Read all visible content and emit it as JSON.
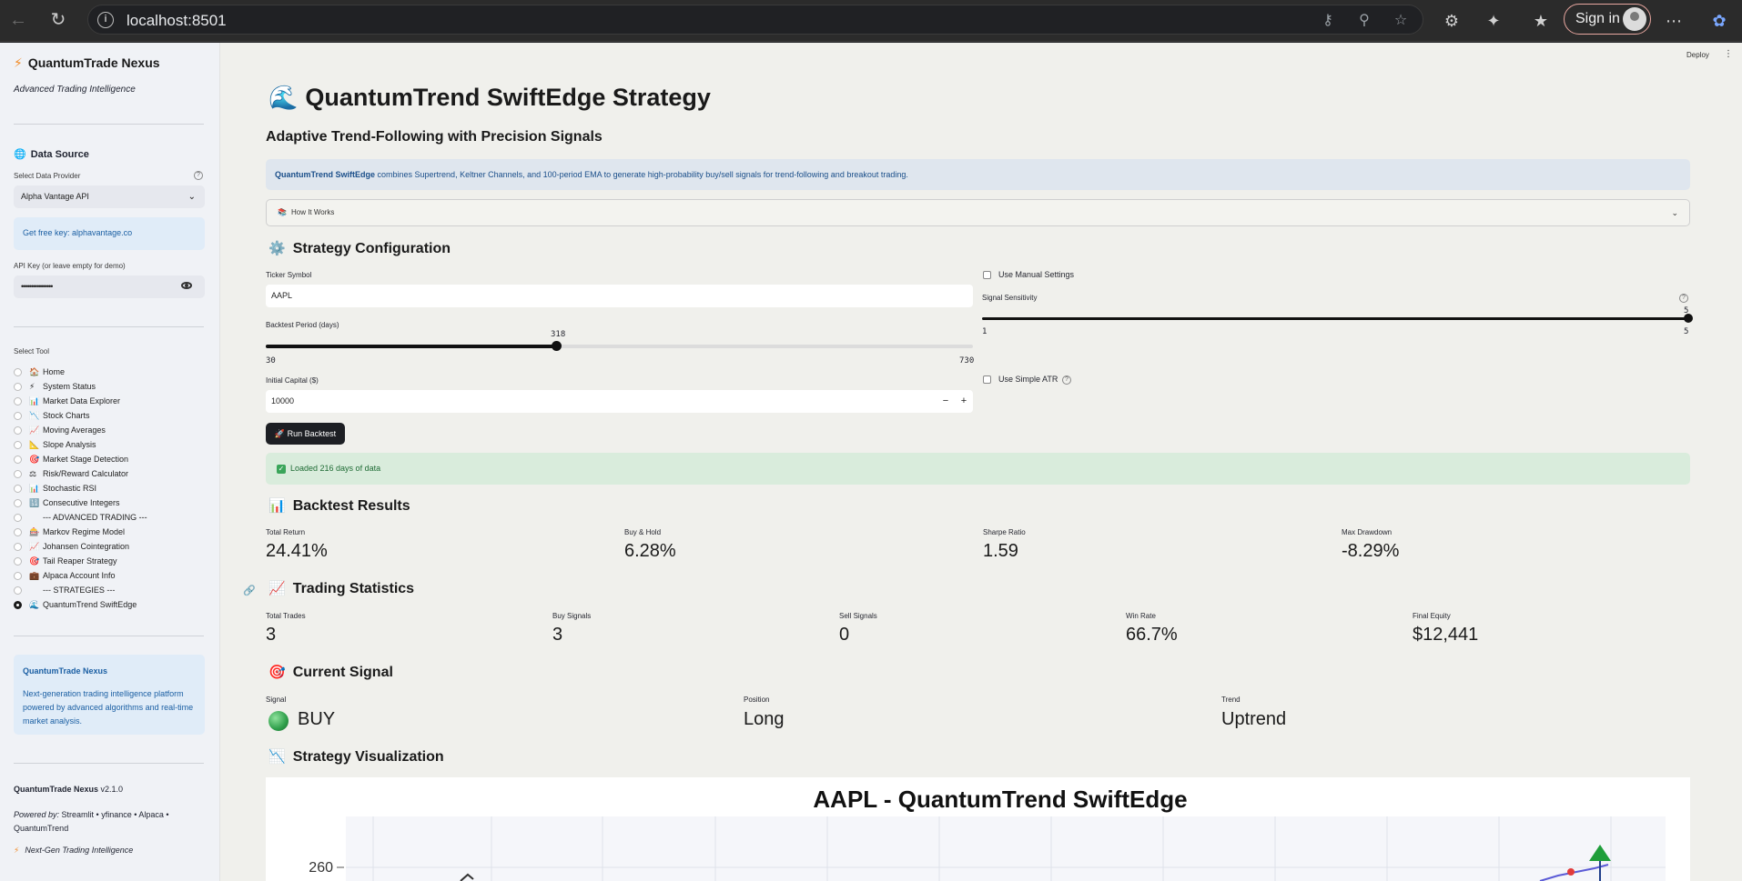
{
  "browser": {
    "url": "localhost:8501",
    "signin_label": "Sign in"
  },
  "app": {
    "deploy_label": "Deploy"
  },
  "sidebar": {
    "brand": "QuantumTrade Nexus",
    "tagline": "Advanced Trading Intelligence",
    "data_source_title": "Data Source",
    "provider_label": "Select Data Provider",
    "provider_value": "Alpha Vantage API",
    "free_key_prefix": "Get free key: ",
    "free_key_link": "alphavantage.co",
    "api_key_label": "API Key (or leave empty for demo)",
    "api_key_value": "••••••••••••••••",
    "tool_label": "Select Tool",
    "tools": [
      {
        "icon": "🏠",
        "label": "Home"
      },
      {
        "icon": "⚡",
        "label": "System Status"
      },
      {
        "icon": "📊",
        "label": "Market Data Explorer"
      },
      {
        "icon": "📉",
        "label": "Stock Charts"
      },
      {
        "icon": "📈",
        "label": "Moving Averages"
      },
      {
        "icon": "📐",
        "label": "Slope Analysis"
      },
      {
        "icon": "🎯",
        "label": "Market Stage Detection"
      },
      {
        "icon": "⚖",
        "label": "Risk/Reward Calculator"
      },
      {
        "icon": "📊",
        "label": "Stochastic RSI"
      },
      {
        "icon": "🔢",
        "label": "Consecutive Integers"
      },
      {
        "icon": "",
        "label": "--- ADVANCED TRADING ---"
      },
      {
        "icon": "🎰",
        "label": "Markov Regime Model"
      },
      {
        "icon": "📈",
        "label": "Johansen Cointegration"
      },
      {
        "icon": "🎯",
        "label": "Tail Reaper Strategy"
      },
      {
        "icon": "💼",
        "label": "Alpaca Account Info"
      },
      {
        "icon": "",
        "label": "--- STRATEGIES ---"
      },
      {
        "icon": "🌊",
        "label": "QuantumTrend SwiftEdge"
      }
    ],
    "selected_tool": "QuantumTrend SwiftEdge",
    "info_title": "QuantumTrade Nexus",
    "info_text": "Next-generation trading intelligence platform powered by advanced algorithms and real-time market analysis.",
    "version_name": "QuantumTrade Nexus",
    "version": "v2.1.0",
    "powered_prefix": "Powered by:",
    "powered_list": "Streamlit • yfinance • Alpaca • QuantumTrend",
    "footer_tag": "Next-Gen Trading Intelligence"
  },
  "main": {
    "title_icon": "🌊",
    "title": "QuantumTrend SwiftEdge Strategy",
    "subtitle": "Adaptive Trend-Following with Precision Signals",
    "banner_bold": "QuantumTrend SwiftEdge",
    "banner_text": " combines Supertrend, Keltner Channels, and 100-period EMA to generate high-probability buy/sell signals for trend-following and breakout trading.",
    "expander_icon": "📚",
    "expander_label": "How It Works",
    "config_icon": "⚙️",
    "config_title": "Strategy Configuration",
    "ticker_label": "Ticker Symbol",
    "ticker_value": "AAPL",
    "backtest_label": "Backtest Period (days)",
    "backtest_value": "318",
    "backtest_min": "30",
    "backtest_max": "730",
    "backtest_fraction": 0.411,
    "capital_label": "Initial Capital ($)",
    "capital_value": "10000",
    "run_label": "🚀 Run Backtest",
    "manual_label": "Use Manual Settings",
    "sensitivity_label": "Signal Sensitivity",
    "sensitivity_value": "5",
    "sensitivity_min": "1",
    "sensitivity_max": "5",
    "atr_label": "Use Simple ATR",
    "success_text": "Loaded 216 days of data",
    "results_icon": "📊",
    "results_title": "Backtest Results",
    "results": [
      {
        "label": "Total Return",
        "value": "24.41%"
      },
      {
        "label": "Buy & Hold",
        "value": "6.28%"
      },
      {
        "label": "Sharpe Ratio",
        "value": "1.59"
      },
      {
        "label": "Max Drawdown",
        "value": "-8.29%"
      }
    ],
    "stats_icon": "📈",
    "stats_title": "Trading Statistics",
    "stats": [
      {
        "label": "Total Trades",
        "value": "3"
      },
      {
        "label": "Buy Signals",
        "value": "3"
      },
      {
        "label": "Sell Signals",
        "value": "0"
      },
      {
        "label": "Win Rate",
        "value": "66.7%"
      },
      {
        "label": "Final Equity",
        "value": "$12,441"
      }
    ],
    "signal_icon": "🎯",
    "signal_title": "Current Signal",
    "signal": [
      {
        "label": "Signal",
        "value": "BUY"
      },
      {
        "label": "Position",
        "value": "Long"
      },
      {
        "label": "Trend",
        "value": "Uptrend"
      }
    ],
    "viz_icon": "📉",
    "viz_title": "Strategy Visualization",
    "chart_title": "AAPL - QuantumTrend SwiftEdge",
    "chart_ytick": "260"
  },
  "colors": {
    "accent_dark": "#1d1f24",
    "info_bg": "#e0ecf8",
    "success_bg": "#d9ecdc",
    "buy_green": "#2e9e4a"
  }
}
